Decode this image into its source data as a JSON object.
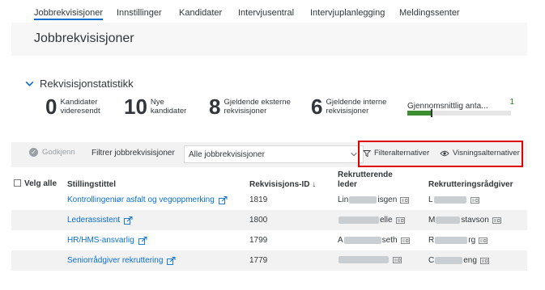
{
  "nav": {
    "tabs": [
      {
        "label": "Jobbrekvisisjoner",
        "active": true
      },
      {
        "label": "Innstillinger"
      },
      {
        "label": "Kandidater"
      },
      {
        "label": "Intervjusentral"
      },
      {
        "label": "Intervjuplanlegging"
      },
      {
        "label": "Meldingssenter"
      }
    ]
  },
  "page": {
    "title": "Jobbrekvisisjoner"
  },
  "stats": {
    "title": "Rekvisisjonstatistikk",
    "kpis": [
      {
        "value": "0",
        "label_line1": "Kandidater",
        "label_line2": "videresendt"
      },
      {
        "value": "10",
        "label_line1": "Nye",
        "label_line2": "kandidater"
      },
      {
        "value": "8",
        "label_line1": "Gjeldende eksterne",
        "label_line2": "rekvisisjoner"
      },
      {
        "value": "6",
        "label_line1": "Gjeldende interne",
        "label_line2": "rekvisisjoner"
      }
    ],
    "average": {
      "label": "Gjennomsnittlig anta...",
      "value": "1",
      "progress": 0.23,
      "bar_color": "#3c8d2f"
    }
  },
  "toolbar": {
    "approve_label": "Godkjenn",
    "filter_label": "Filtrer jobbrekvisisjoner",
    "filter_value": "Alle jobbrekvisisjoner",
    "filter_options_label": "Filteralternativer",
    "view_options_label": "Visningsalternativer"
  },
  "table": {
    "select_all_label": "Velg alle",
    "columns": {
      "title": "Stillingstittel",
      "id": "Rekvisisjons-ID ↓",
      "leader_line1": "Rekrutterende",
      "leader_line2": "leder",
      "advisor": "Rekrutteringsrådgiver"
    },
    "rows": [
      {
        "title": "Kontrollingeniør asfalt og vegoppmerking",
        "id": "1819",
        "leader_left": "Lin",
        "leader_right": "isgen",
        "advisor_left": "L",
        "advisor_right": ""
      },
      {
        "title": "Lederassistent",
        "id": "1800",
        "leader_left": "",
        "leader_right": "elle",
        "advisor_left": "M",
        "advisor_right": "stavson"
      },
      {
        "title": "HR/HMS-ansvarlig",
        "id": "1799",
        "leader_left": "A",
        "leader_right": "seth",
        "advisor_left": "R",
        "advisor_right": "rg"
      },
      {
        "title": "Seniorrådgiver rekruttering",
        "id": "1779",
        "leader_left": "",
        "leader_right": "",
        "advisor_left": "C",
        "advisor_right": "eng"
      }
    ]
  },
  "colors": {
    "link": "#0a6ed1",
    "highlight": "#e00000",
    "accent": "#3c8d2f"
  },
  "icons": [
    "chevron-down-icon",
    "approve-check-icon",
    "filter-icon",
    "eye-icon",
    "external-link-icon",
    "contact-card-icon"
  ]
}
